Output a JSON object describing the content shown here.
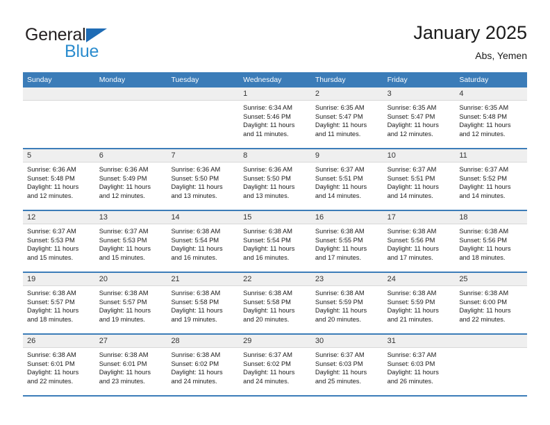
{
  "brand": {
    "name_line1": "General",
    "name_line2": "Blue",
    "color_dark": "#231f20",
    "color_blue": "#2b8cce",
    "triangle_color": "#1f6cb5"
  },
  "header": {
    "title": "January 2025",
    "subtitle": "Abs, Yemen"
  },
  "theme": {
    "header_bar": "#3b7cb8",
    "day_band": "#efefef",
    "text": "#1a1a1a"
  },
  "weekdays": [
    "Sunday",
    "Monday",
    "Tuesday",
    "Wednesday",
    "Thursday",
    "Friday",
    "Saturday"
  ],
  "weeks": [
    [
      {
        "day": "",
        "empty": true,
        "sunrise": "",
        "sunset": "",
        "daylight_line1": "",
        "daylight_line2": ""
      },
      {
        "day": "",
        "empty": true,
        "sunrise": "",
        "sunset": "",
        "daylight_line1": "",
        "daylight_line2": ""
      },
      {
        "day": "",
        "empty": true,
        "sunrise": "",
        "sunset": "",
        "daylight_line1": "",
        "daylight_line2": ""
      },
      {
        "day": "1",
        "empty": false,
        "sunrise": "Sunrise: 6:34 AM",
        "sunset": "Sunset: 5:46 PM",
        "daylight_line1": "Daylight: 11 hours",
        "daylight_line2": "and 11 minutes."
      },
      {
        "day": "2",
        "empty": false,
        "sunrise": "Sunrise: 6:35 AM",
        "sunset": "Sunset: 5:47 PM",
        "daylight_line1": "Daylight: 11 hours",
        "daylight_line2": "and 11 minutes."
      },
      {
        "day": "3",
        "empty": false,
        "sunrise": "Sunrise: 6:35 AM",
        "sunset": "Sunset: 5:47 PM",
        "daylight_line1": "Daylight: 11 hours",
        "daylight_line2": "and 12 minutes."
      },
      {
        "day": "4",
        "empty": false,
        "sunrise": "Sunrise: 6:35 AM",
        "sunset": "Sunset: 5:48 PM",
        "daylight_line1": "Daylight: 11 hours",
        "daylight_line2": "and 12 minutes."
      }
    ],
    [
      {
        "day": "5",
        "empty": false,
        "sunrise": "Sunrise: 6:36 AM",
        "sunset": "Sunset: 5:48 PM",
        "daylight_line1": "Daylight: 11 hours",
        "daylight_line2": "and 12 minutes."
      },
      {
        "day": "6",
        "empty": false,
        "sunrise": "Sunrise: 6:36 AM",
        "sunset": "Sunset: 5:49 PM",
        "daylight_line1": "Daylight: 11 hours",
        "daylight_line2": "and 12 minutes."
      },
      {
        "day": "7",
        "empty": false,
        "sunrise": "Sunrise: 6:36 AM",
        "sunset": "Sunset: 5:50 PM",
        "daylight_line1": "Daylight: 11 hours",
        "daylight_line2": "and 13 minutes."
      },
      {
        "day": "8",
        "empty": false,
        "sunrise": "Sunrise: 6:36 AM",
        "sunset": "Sunset: 5:50 PM",
        "daylight_line1": "Daylight: 11 hours",
        "daylight_line2": "and 13 minutes."
      },
      {
        "day": "9",
        "empty": false,
        "sunrise": "Sunrise: 6:37 AM",
        "sunset": "Sunset: 5:51 PM",
        "daylight_line1": "Daylight: 11 hours",
        "daylight_line2": "and 14 minutes."
      },
      {
        "day": "10",
        "empty": false,
        "sunrise": "Sunrise: 6:37 AM",
        "sunset": "Sunset: 5:51 PM",
        "daylight_line1": "Daylight: 11 hours",
        "daylight_line2": "and 14 minutes."
      },
      {
        "day": "11",
        "empty": false,
        "sunrise": "Sunrise: 6:37 AM",
        "sunset": "Sunset: 5:52 PM",
        "daylight_line1": "Daylight: 11 hours",
        "daylight_line2": "and 14 minutes."
      }
    ],
    [
      {
        "day": "12",
        "empty": false,
        "sunrise": "Sunrise: 6:37 AM",
        "sunset": "Sunset: 5:53 PM",
        "daylight_line1": "Daylight: 11 hours",
        "daylight_line2": "and 15 minutes."
      },
      {
        "day": "13",
        "empty": false,
        "sunrise": "Sunrise: 6:37 AM",
        "sunset": "Sunset: 5:53 PM",
        "daylight_line1": "Daylight: 11 hours",
        "daylight_line2": "and 15 minutes."
      },
      {
        "day": "14",
        "empty": false,
        "sunrise": "Sunrise: 6:38 AM",
        "sunset": "Sunset: 5:54 PM",
        "daylight_line1": "Daylight: 11 hours",
        "daylight_line2": "and 16 minutes."
      },
      {
        "day": "15",
        "empty": false,
        "sunrise": "Sunrise: 6:38 AM",
        "sunset": "Sunset: 5:54 PM",
        "daylight_line1": "Daylight: 11 hours",
        "daylight_line2": "and 16 minutes."
      },
      {
        "day": "16",
        "empty": false,
        "sunrise": "Sunrise: 6:38 AM",
        "sunset": "Sunset: 5:55 PM",
        "daylight_line1": "Daylight: 11 hours",
        "daylight_line2": "and 17 minutes."
      },
      {
        "day": "17",
        "empty": false,
        "sunrise": "Sunrise: 6:38 AM",
        "sunset": "Sunset: 5:56 PM",
        "daylight_line1": "Daylight: 11 hours",
        "daylight_line2": "and 17 minutes."
      },
      {
        "day": "18",
        "empty": false,
        "sunrise": "Sunrise: 6:38 AM",
        "sunset": "Sunset: 5:56 PM",
        "daylight_line1": "Daylight: 11 hours",
        "daylight_line2": "and 18 minutes."
      }
    ],
    [
      {
        "day": "19",
        "empty": false,
        "sunrise": "Sunrise: 6:38 AM",
        "sunset": "Sunset: 5:57 PM",
        "daylight_line1": "Daylight: 11 hours",
        "daylight_line2": "and 18 minutes."
      },
      {
        "day": "20",
        "empty": false,
        "sunrise": "Sunrise: 6:38 AM",
        "sunset": "Sunset: 5:57 PM",
        "daylight_line1": "Daylight: 11 hours",
        "daylight_line2": "and 19 minutes."
      },
      {
        "day": "21",
        "empty": false,
        "sunrise": "Sunrise: 6:38 AM",
        "sunset": "Sunset: 5:58 PM",
        "daylight_line1": "Daylight: 11 hours",
        "daylight_line2": "and 19 minutes."
      },
      {
        "day": "22",
        "empty": false,
        "sunrise": "Sunrise: 6:38 AM",
        "sunset": "Sunset: 5:58 PM",
        "daylight_line1": "Daylight: 11 hours",
        "daylight_line2": "and 20 minutes."
      },
      {
        "day": "23",
        "empty": false,
        "sunrise": "Sunrise: 6:38 AM",
        "sunset": "Sunset: 5:59 PM",
        "daylight_line1": "Daylight: 11 hours",
        "daylight_line2": "and 20 minutes."
      },
      {
        "day": "24",
        "empty": false,
        "sunrise": "Sunrise: 6:38 AM",
        "sunset": "Sunset: 5:59 PM",
        "daylight_line1": "Daylight: 11 hours",
        "daylight_line2": "and 21 minutes."
      },
      {
        "day": "25",
        "empty": false,
        "sunrise": "Sunrise: 6:38 AM",
        "sunset": "Sunset: 6:00 PM",
        "daylight_line1": "Daylight: 11 hours",
        "daylight_line2": "and 22 minutes."
      }
    ],
    [
      {
        "day": "26",
        "empty": false,
        "sunrise": "Sunrise: 6:38 AM",
        "sunset": "Sunset: 6:01 PM",
        "daylight_line1": "Daylight: 11 hours",
        "daylight_line2": "and 22 minutes."
      },
      {
        "day": "27",
        "empty": false,
        "sunrise": "Sunrise: 6:38 AM",
        "sunset": "Sunset: 6:01 PM",
        "daylight_line1": "Daylight: 11 hours",
        "daylight_line2": "and 23 minutes."
      },
      {
        "day": "28",
        "empty": false,
        "sunrise": "Sunrise: 6:38 AM",
        "sunset": "Sunset: 6:02 PM",
        "daylight_line1": "Daylight: 11 hours",
        "daylight_line2": "and 24 minutes."
      },
      {
        "day": "29",
        "empty": false,
        "sunrise": "Sunrise: 6:37 AM",
        "sunset": "Sunset: 6:02 PM",
        "daylight_line1": "Daylight: 11 hours",
        "daylight_line2": "and 24 minutes."
      },
      {
        "day": "30",
        "empty": false,
        "sunrise": "Sunrise: 6:37 AM",
        "sunset": "Sunset: 6:03 PM",
        "daylight_line1": "Daylight: 11 hours",
        "daylight_line2": "and 25 minutes."
      },
      {
        "day": "31",
        "empty": false,
        "sunrise": "Sunrise: 6:37 AM",
        "sunset": "Sunset: 6:03 PM",
        "daylight_line1": "Daylight: 11 hours",
        "daylight_line2": "and 26 minutes."
      },
      {
        "day": "",
        "empty": true,
        "sunrise": "",
        "sunset": "",
        "daylight_line1": "",
        "daylight_line2": ""
      }
    ]
  ]
}
